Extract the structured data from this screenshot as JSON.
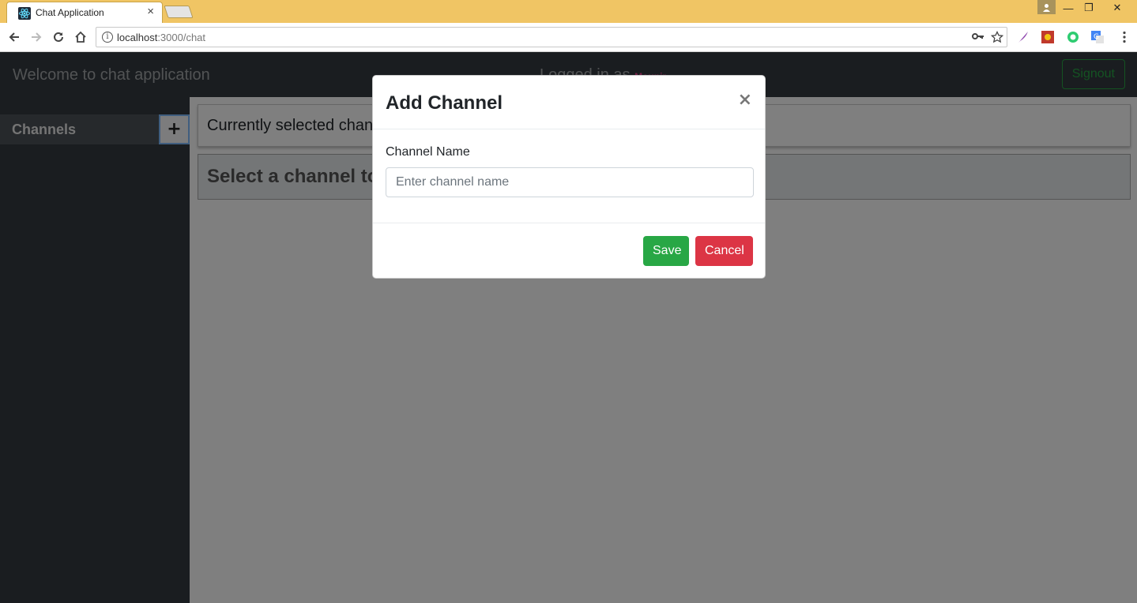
{
  "browser": {
    "tab_title": "Chat Application",
    "tab_close": "×",
    "url_host": "localhost",
    "url_path": ":3000/chat",
    "window_controls": {
      "minimize": "—",
      "restore": "❐",
      "close": "✕"
    }
  },
  "app": {
    "title": "Welcome to chat application",
    "logged_in_prefix": "Logged in as",
    "username": "Mounir",
    "signout_label": "Signout"
  },
  "sidebar": {
    "channels_label": "Channels",
    "add_channel_symbol": "+"
  },
  "main": {
    "currently_selected": "Currently selected channel",
    "select_prompt": "Select a channel to start chatting"
  },
  "modal": {
    "title": "Add Channel",
    "close_symbol": "×",
    "field_label": "Channel Name",
    "field_placeholder": "Enter channel name",
    "field_value": "",
    "save_label": "Save",
    "cancel_label": "Cancel"
  },
  "colors": {
    "tabstrip": "#f0c564",
    "navbar": "#343a40",
    "success": "#28a745",
    "danger": "#dc3545",
    "username": "#e83e8c"
  },
  "icons": {
    "back": "back-arrow-icon",
    "forward": "forward-arrow-icon",
    "reload": "reload-icon",
    "home": "home-icon",
    "info": "info-icon",
    "key": "key-icon",
    "star": "bookmark-star-icon",
    "menu": "kebab-menu-icon"
  }
}
